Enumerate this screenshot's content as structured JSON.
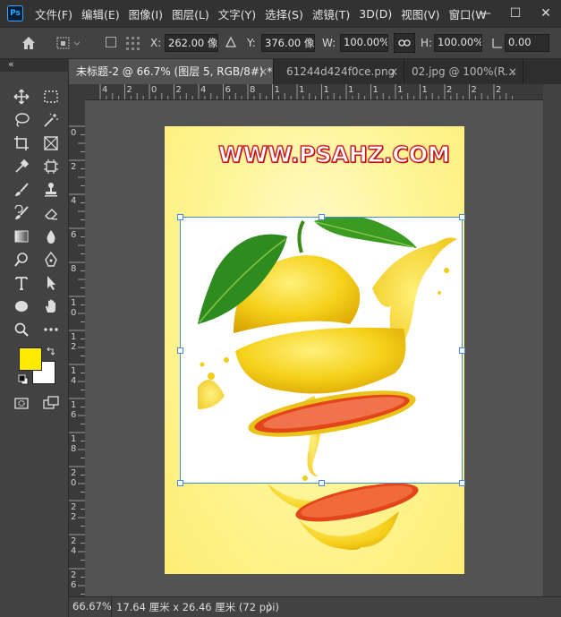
{
  "app": {
    "logo": "Ps",
    "menu": [
      "文件(F)",
      "编辑(E)",
      "图像(I)",
      "图层(L)",
      "文字(Y)",
      "选择(S)",
      "滤镜(T)",
      "3D(D)",
      "视图(V)",
      "窗口(W"
    ],
    "window_controls": [
      "—",
      "☐",
      "✕"
    ]
  },
  "options": {
    "x_label": "X:",
    "x_value": "262.00 像",
    "y_label": "Y:",
    "y_value": "376.00 像",
    "w_label": "W:",
    "w_value": "100.00%",
    "h_label": "H:",
    "h_value": "100.00%",
    "angle_value": "0.00"
  },
  "tabs": [
    {
      "label": "未标题-2 @ 66.7% (图层 5, RGB/8#) *",
      "close": "×",
      "active": true
    },
    {
      "label": "61244d424f0ce.png",
      "close": "×",
      "active": false
    },
    {
      "label": "02.jpg @ 100%(R...",
      "close": "×",
      "active": false
    }
  ],
  "toolbar": {
    "collapse": "«",
    "foreground_color": "#ffea00",
    "background_color": "#ffffff"
  },
  "rulers": {
    "horizontal_ticks": [
      "4",
      "2",
      "0",
      "2",
      "4",
      "6",
      "8",
      "1",
      "1",
      "1",
      "1",
      "1",
      "1",
      "1",
      "2",
      "2",
      "2"
    ],
    "vertical_ticks": [
      "0",
      "2",
      "4",
      "6",
      "8",
      "1\n0",
      "1\n2",
      "1\n4",
      "1\n6",
      "1\n8",
      "2\n0",
      "2\n2",
      "2\n4",
      "2\n6"
    ]
  },
  "canvas": {
    "watermark": "WWW.PSAHZ.COM"
  },
  "status": {
    "zoom": "66.67%",
    "doc_info": "17.64 厘米 x 26.46 厘米 (72 ppi)",
    "arrow": "〉"
  }
}
